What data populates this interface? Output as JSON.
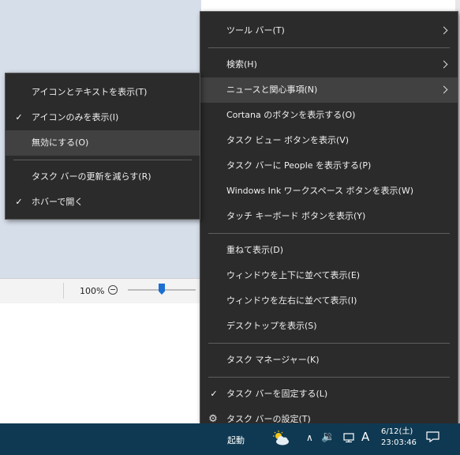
{
  "background": {
    "zoom_label": "100%"
  },
  "main_menu": {
    "items": [
      {
        "label": "ツール バー(T)",
        "submenu": true
      },
      {
        "label": "検索(H)",
        "submenu": true
      },
      {
        "label": "ニュースと関心事項(N)",
        "submenu": true,
        "highlighted": true
      },
      {
        "label": "Cortana のボタンを表示する(O)"
      },
      {
        "label": "タスク ビュー ボタンを表示(V)"
      },
      {
        "label": "タスク バーに People を表示する(P)"
      },
      {
        "label": "Windows Ink ワークスペース ボタンを表示(W)"
      },
      {
        "label": "タッチ キーボード ボタンを表示(Y)"
      },
      {
        "label": "重ねて表示(D)"
      },
      {
        "label": "ウィンドウを上下に並べて表示(E)"
      },
      {
        "label": "ウィンドウを左右に並べて表示(I)"
      },
      {
        "label": "デスクトップを表示(S)"
      },
      {
        "label": "タスク マネージャー(K)"
      },
      {
        "label": "タスク バーを固定する(L)",
        "checked": true
      },
      {
        "label": "タスク バーの設定(T)",
        "icon": "gear-icon"
      }
    ]
  },
  "sub_menu": {
    "items": [
      {
        "label": "アイコンとテキストを表示(T)"
      },
      {
        "label": "アイコンのみを表示(I)",
        "checked": true
      },
      {
        "label": "無効にする(O)",
        "highlighted": true
      },
      {
        "label": "タスク バーの更新を減らす(R)"
      },
      {
        "label": "ホバーで開く",
        "checked": true
      }
    ]
  },
  "taskbar": {
    "start_label": "起動",
    "weather_icon": "weather-sun-cloud-icon",
    "ime_label": "A",
    "date": "6/12(土)",
    "time": "23:03:46",
    "color": "#0f3952"
  },
  "colors": {
    "menu_bg": "#2b2b2b",
    "menu_highlight": "#414141",
    "menu_text": "#f0f0f0"
  }
}
